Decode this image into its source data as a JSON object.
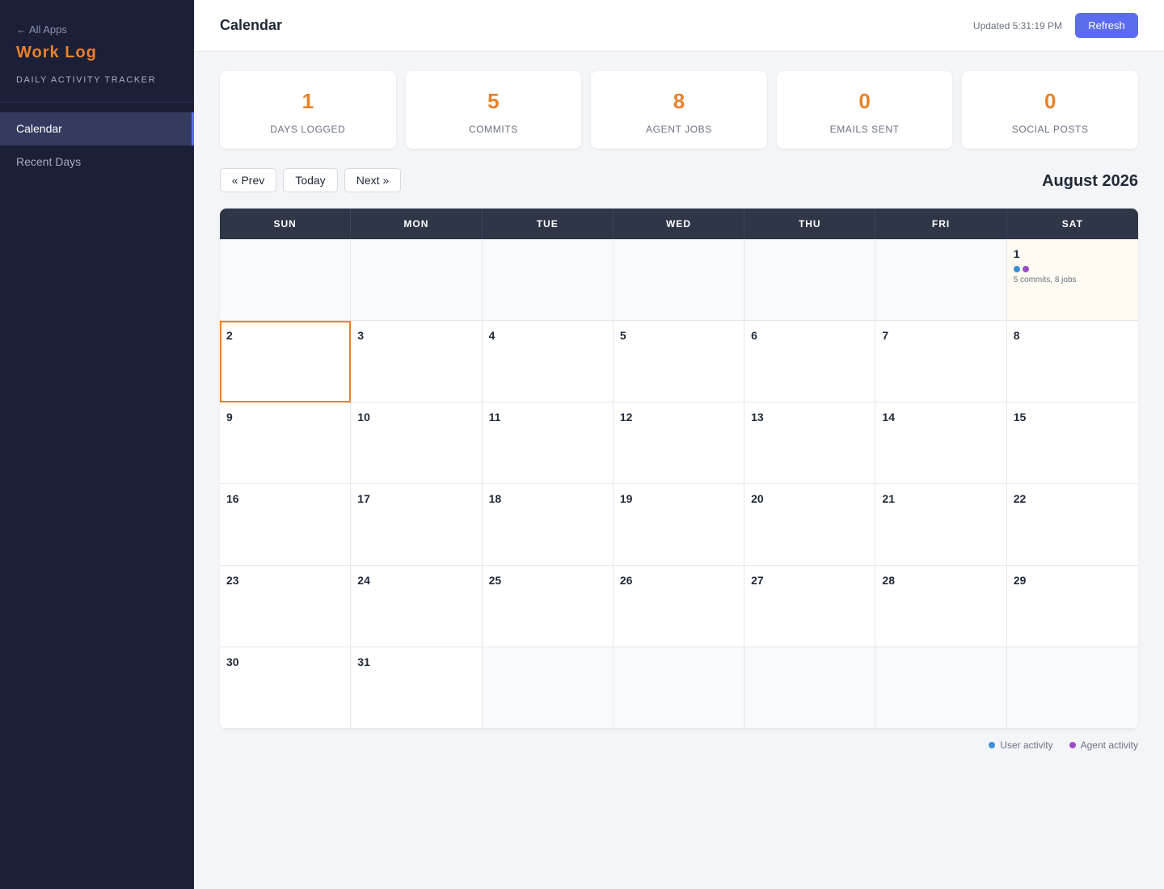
{
  "sidebar": {
    "back_label": "← All Apps",
    "app_title": "Work Log",
    "app_subtitle": "DAILY ACTIVITY TRACKER",
    "nav": [
      {
        "label": "Calendar",
        "active": true
      },
      {
        "label": "Recent Days",
        "active": false
      }
    ]
  },
  "header": {
    "title": "Calendar",
    "updated": "Updated 5:31:19 PM",
    "refresh_label": "Refresh"
  },
  "stats": [
    {
      "value": "1",
      "label": "DAYS LOGGED"
    },
    {
      "value": "5",
      "label": "COMMITS"
    },
    {
      "value": "8",
      "label": "AGENT JOBS"
    },
    {
      "value": "0",
      "label": "EMAILS SENT"
    },
    {
      "value": "0",
      "label": "SOCIAL POSTS"
    }
  ],
  "controls": {
    "prev_label": "« Prev",
    "today_label": "Today",
    "next_label": "Next »",
    "month_label": "August 2026"
  },
  "calendar": {
    "weekdays": [
      "SUN",
      "MON",
      "TUE",
      "WED",
      "THU",
      "FRI",
      "SAT"
    ],
    "days": [
      {
        "day": "",
        "empty": true
      },
      {
        "day": "",
        "empty": true
      },
      {
        "day": "",
        "empty": true
      },
      {
        "day": "",
        "empty": true
      },
      {
        "day": "",
        "empty": true
      },
      {
        "day": "",
        "empty": true
      },
      {
        "day": "1",
        "user": true,
        "agent": true,
        "summary": "5 commits, 8 jobs"
      },
      {
        "day": "2",
        "today": true
      },
      {
        "day": "3"
      },
      {
        "day": "4"
      },
      {
        "day": "5"
      },
      {
        "day": "6"
      },
      {
        "day": "7"
      },
      {
        "day": "8"
      },
      {
        "day": "9"
      },
      {
        "day": "10"
      },
      {
        "day": "11"
      },
      {
        "day": "12"
      },
      {
        "day": "13"
      },
      {
        "day": "14"
      },
      {
        "day": "15"
      },
      {
        "day": "16"
      },
      {
        "day": "17"
      },
      {
        "day": "18"
      },
      {
        "day": "19"
      },
      {
        "day": "20"
      },
      {
        "day": "21"
      },
      {
        "day": "22"
      },
      {
        "day": "23"
      },
      {
        "day": "24"
      },
      {
        "day": "25"
      },
      {
        "day": "26"
      },
      {
        "day": "27"
      },
      {
        "day": "28"
      },
      {
        "day": "29"
      },
      {
        "day": "30"
      },
      {
        "day": "31"
      },
      {
        "day": "",
        "empty": true
      },
      {
        "day": "",
        "empty": true
      },
      {
        "day": "",
        "empty": true
      },
      {
        "day": "",
        "empty": true
      },
      {
        "day": "",
        "empty": true
      }
    ]
  },
  "legend": {
    "user_label": "User activity",
    "agent_label": "Agent activity",
    "user_color": "#3b8fd6",
    "agent_color": "#9b4fc4"
  },
  "colors": {
    "accent": "#e8822a",
    "primary": "#5b6cf0",
    "sidebar_bg": "#1b1f37"
  }
}
